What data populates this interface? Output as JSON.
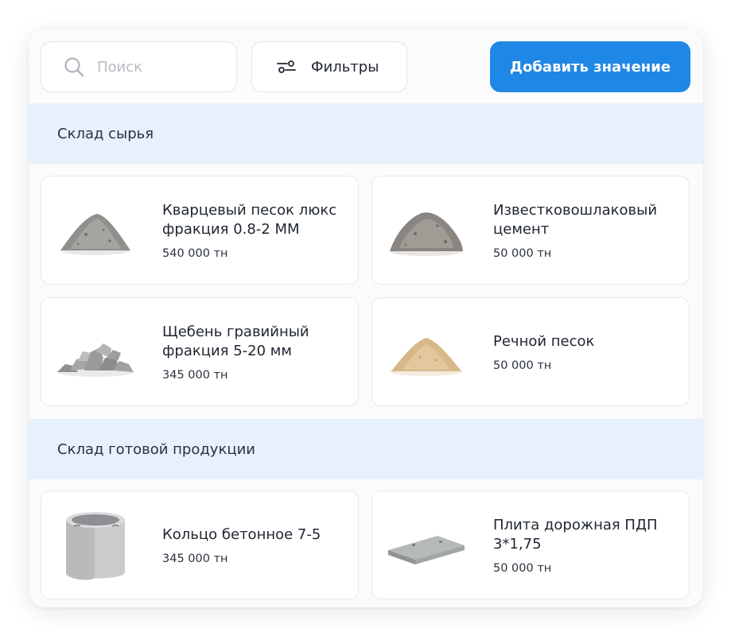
{
  "search": {
    "placeholder": "Поиск",
    "value": ""
  },
  "filters": {
    "label": "Фильтры"
  },
  "add_button": {
    "label": "Добавить значение"
  },
  "colors": {
    "accent": "#1f87e5",
    "section_bg": "#e6f1fc"
  },
  "sections": [
    {
      "title": "Склад сырья",
      "items": [
        {
          "title": "Кварцевый песок люкс фракция 0.8-2 ММ",
          "qty": "540 000 тн",
          "image": "quartz-sand-pile"
        },
        {
          "title": "Известковошлаковый цемент",
          "qty": "50 000 тн",
          "image": "cement-pile"
        },
        {
          "title": "Щебень гравийный фракция 5-20 мм",
          "qty": "345 000 тн",
          "image": "gravel-pile"
        },
        {
          "title": "Речной песок",
          "qty": "50 000 тн",
          "image": "river-sand-pile"
        }
      ]
    },
    {
      "title": "Склад готовой продукции",
      "items": [
        {
          "title": "Кольцо бетонное 7-5",
          "qty": "345 000 тн",
          "image": "concrete-ring"
        },
        {
          "title": "Плита дорожная ПДП 3*1,75",
          "qty": "50 000 тн",
          "image": "road-slab"
        }
      ]
    }
  ]
}
